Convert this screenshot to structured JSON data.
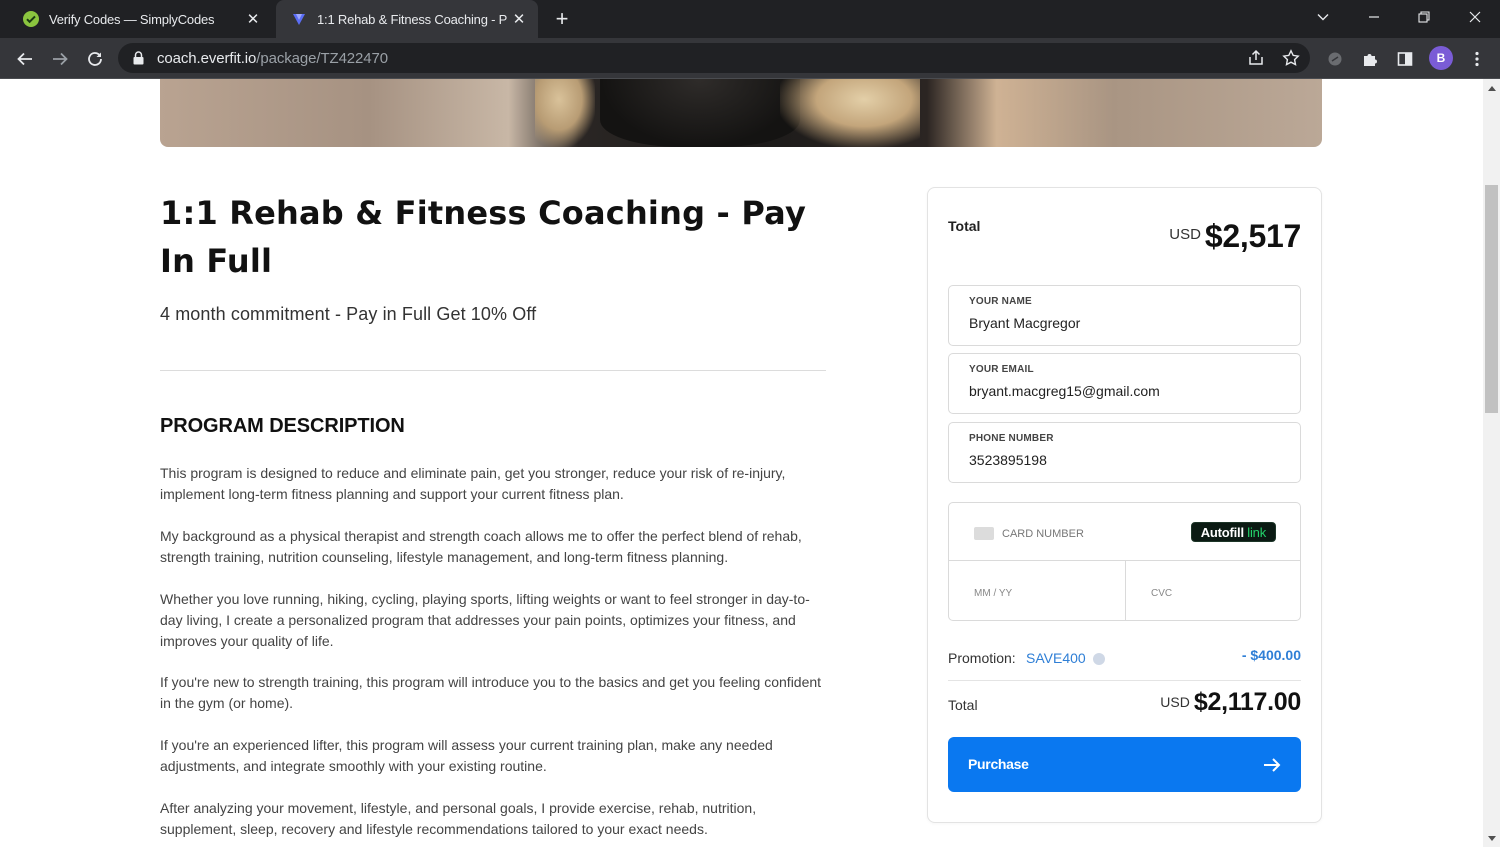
{
  "browser": {
    "tabs": [
      {
        "title": "Verify Codes — SimplyCodes",
        "icon": "simplycodes-check-icon",
        "active": false
      },
      {
        "title": "1:1 Rehab & Fitness Coaching - P",
        "icon": "everfit-logo-icon",
        "active": true
      }
    ],
    "new_tab_label": "+",
    "url_host": "coach.everfit.io",
    "url_path": "/package/TZ422470",
    "profile_initial": "B"
  },
  "page": {
    "title": "1:1 Rehab & Fitness Coaching - Pay In Full",
    "subtitle": "4 month commitment - Pay in Full Get 10% Off",
    "section_heading": "PROGRAM DESCRIPTION",
    "paragraphs": [
      "This program is designed to reduce and eliminate pain, get you stronger, reduce your risk of re-injury, implement long-term fitness planning and support your current fitness plan.",
      "My background as a physical therapist and strength coach allows me to offer the perfect blend of rehab, strength training, nutrition counseling, lifestyle management, and long-term fitness planning.",
      "Whether you love running, hiking, cycling, playing sports, lifting weights or want to feel stronger in day-to-day living, I create a personalized program that addresses your pain points, optimizes your fitness, and improves your quality of life.",
      "If you're new to strength training, this program will introduce you to the basics and get you feeling confident in the gym (or home).",
      "If you're an experienced lifter, this program will assess your current training plan, make any needed adjustments, and integrate smoothly with your existing routine.",
      "After analyzing your movement, lifestyle, and personal goals, I provide exercise, rehab, nutrition, supplement, sleep, recovery and lifestyle recommendations tailored to your exact needs."
    ]
  },
  "checkout": {
    "total_label": "Total",
    "currency": "USD",
    "total_amount": "$2,517",
    "name_label": "YOUR NAME",
    "name_value": "Bryant Macgregor",
    "email_label": "YOUR EMAIL",
    "email_value": "bryant.macgreg15@gmail.com",
    "phone_label": "PHONE NUMBER",
    "phone_value": "3523895198",
    "card_number_placeholder": "CARD NUMBER",
    "autofill_text": "Autofill",
    "autofill_link": "link",
    "expiry_placeholder": "MM / YY",
    "cvc_placeholder": "CVC",
    "promotion_label": "Promotion:",
    "promotion_code": "SAVE400",
    "discount": "- $400.00",
    "final_total_label": "Total",
    "final_amount": "$2,117.00",
    "purchase_label": "Purchase",
    "accent_color": "#0a78f0",
    "promo_color": "#2f7fd6"
  }
}
